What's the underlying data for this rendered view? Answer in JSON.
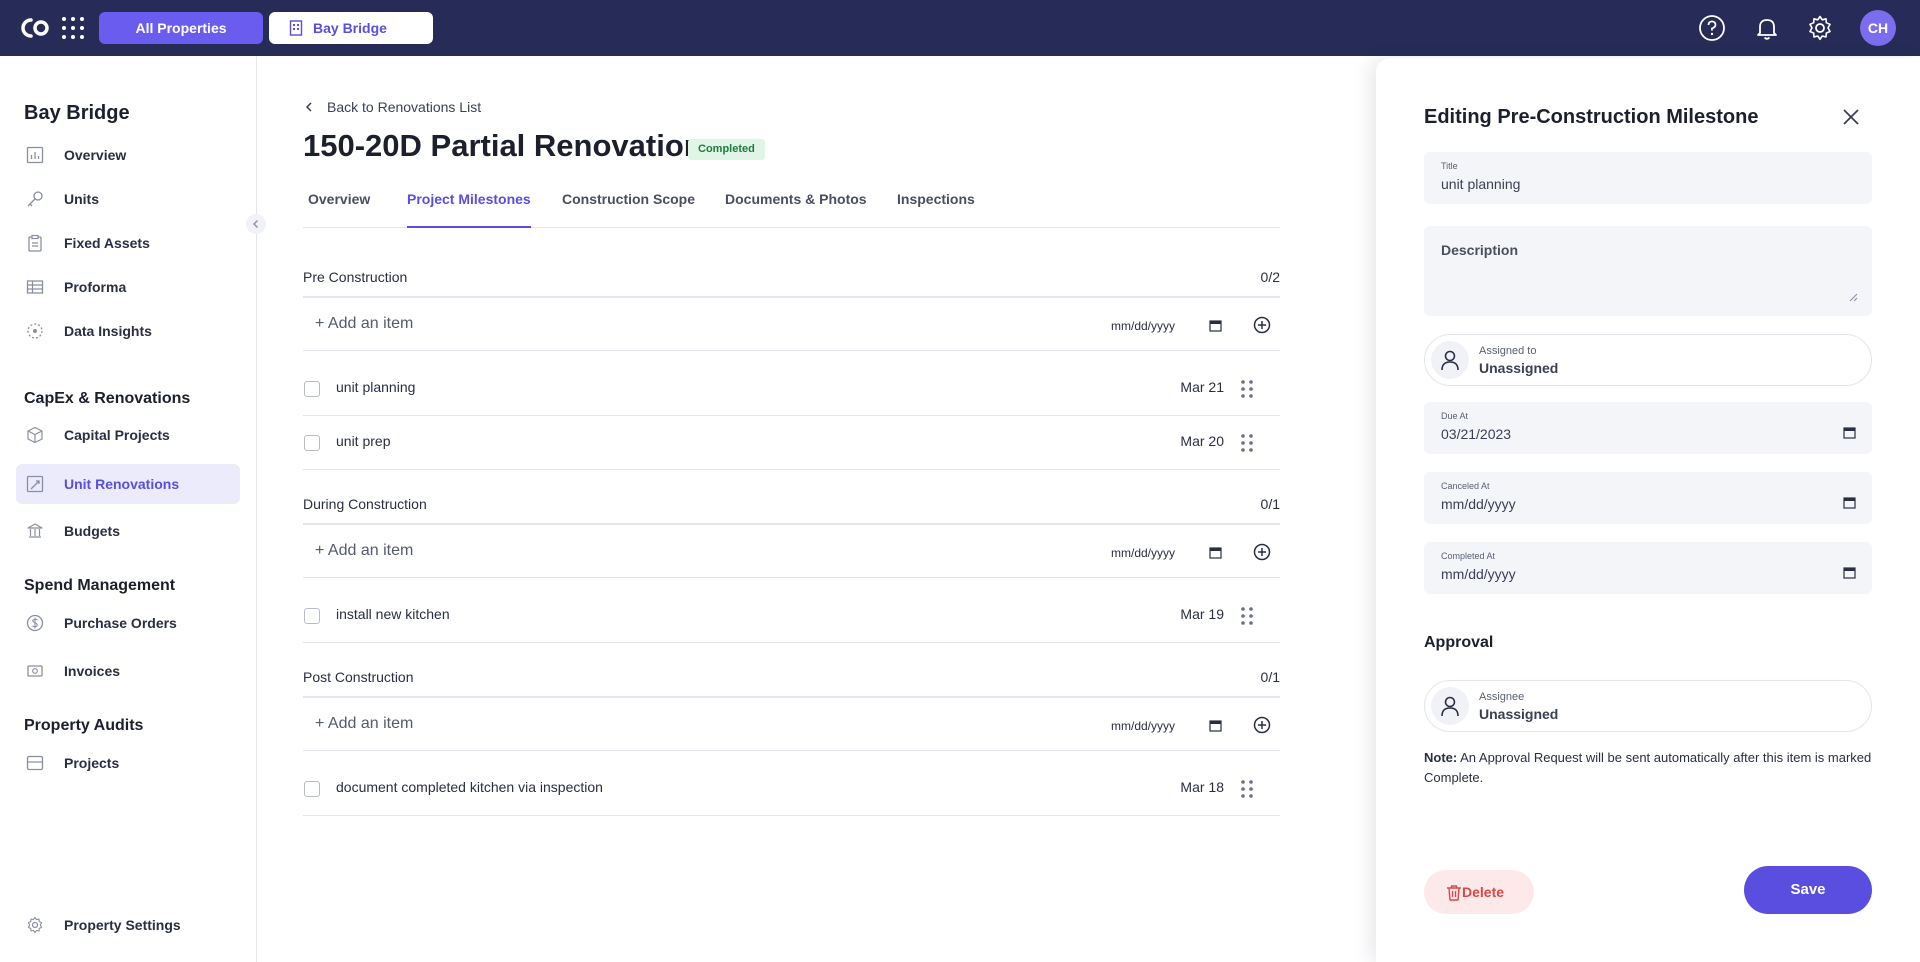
{
  "topbar": {
    "all_properties": "All Properties",
    "property": "Bay Bridge",
    "avatar_initials": "CH"
  },
  "sidebar": {
    "title": "Bay Bridge",
    "items": [
      {
        "label": "Overview",
        "icon": "bar-chart-icon"
      },
      {
        "label": "Units",
        "icon": "key-icon"
      },
      {
        "label": "Fixed Assets",
        "icon": "clipboard-icon"
      },
      {
        "label": "Proforma",
        "icon": "table-icon"
      },
      {
        "label": "Data Insights",
        "icon": "insights-icon"
      }
    ],
    "section_capex": "CapEx & Renovations",
    "capex_items": [
      {
        "label": "Capital Projects",
        "icon": "cube-icon"
      },
      {
        "label": "Unit Renovations",
        "icon": "renovation-icon"
      },
      {
        "label": "Budgets",
        "icon": "bank-icon"
      }
    ],
    "section_spend": "Spend Management",
    "spend_items": [
      {
        "label": "Purchase Orders",
        "icon": "dollar-icon"
      },
      {
        "label": "Invoices",
        "icon": "invoice-icon"
      }
    ],
    "section_audits": "Property Audits",
    "audit_items": [
      {
        "label": "Projects",
        "icon": "projects-icon"
      }
    ],
    "settings": "Property Settings"
  },
  "main": {
    "back_link": "Back to Renovations List",
    "title": "150-20D Partial Renovation",
    "status": "Completed",
    "tabs": [
      "Overview",
      "Project Milestones",
      "Construction Scope",
      "Documents & Photos",
      "Inspections"
    ],
    "active_tab": "Project Milestones",
    "add_item_label": "+ Add an item",
    "date_placeholder": "mm/dd/yyyy",
    "groups": [
      {
        "name": "Pre Construction",
        "count": "0/2",
        "items": [
          {
            "label": "unit planning",
            "date": "Mar 21"
          },
          {
            "label": "unit prep",
            "date": "Mar 20"
          }
        ]
      },
      {
        "name": "During Construction",
        "count": "0/1",
        "items": [
          {
            "label": "install new kitchen",
            "date": "Mar 19"
          }
        ]
      },
      {
        "name": "Post Construction",
        "count": "0/1",
        "items": [
          {
            "label": "document completed kitchen via inspection",
            "date": "Mar 18"
          }
        ]
      }
    ]
  },
  "panel": {
    "title": "Editing Pre-Construction Milestone",
    "title_label": "Title",
    "title_value": "unit planning",
    "description_label": "Description",
    "assigned_label": "Assigned to",
    "assigned_value": "Unassigned",
    "due_label": "Due At",
    "due_value": "03/21/2023",
    "canceled_label": "Canceled At",
    "canceled_value": "mm/dd/yyyy",
    "completed_label": "Completed At",
    "completed_value": "mm/dd/yyyy",
    "approval_title": "Approval",
    "assignee_label": "Assignee",
    "assignee_value": "Unassigned",
    "note_bold": "Note:",
    "note_text": " An Approval Request will be sent automatically after this item is marked Complete.",
    "delete_label": "Delete",
    "save_label": "Save"
  },
  "colors": {
    "topbar": "#262c57",
    "accent": "#5a4ee0",
    "status_bg": "#dff5e6",
    "delete_bg": "#fde9e9"
  }
}
